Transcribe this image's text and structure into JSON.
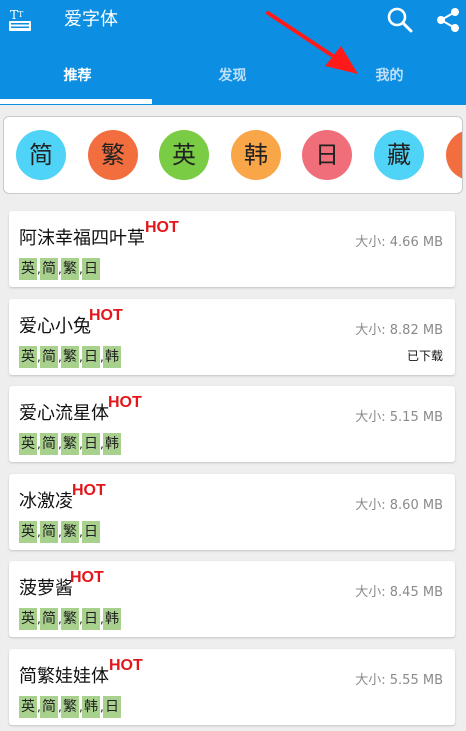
{
  "appbar": {
    "title": "爱字体",
    "tabs": [
      "推荐",
      "发现",
      "我的"
    ],
    "active_tab": 0,
    "color": "#0c8fe3"
  },
  "languages": [
    {
      "label": "简",
      "color": "#4fd3f7"
    },
    {
      "label": "繁",
      "color": "#f26e3f"
    },
    {
      "label": "英",
      "color": "#79cc43"
    },
    {
      "label": "韩",
      "color": "#f8a647"
    },
    {
      "label": "日",
      "color": "#f06e7a"
    },
    {
      "label": "藏",
      "color": "#4fd3f7"
    },
    {
      "label": "",
      "color": "#f26e3f"
    }
  ],
  "fonts": [
    {
      "name": "阿沫幸福四叶草",
      "hot": "HOT",
      "size": "大小: 4.66 MB",
      "tags": [
        "英",
        "简",
        "繁",
        "日"
      ],
      "status": ""
    },
    {
      "name": "爱心小兔",
      "hot": "HOT",
      "size": "大小: 8.82 MB",
      "tags": [
        "英",
        "简",
        "繁",
        "日",
        "韩"
      ],
      "status": "已下载"
    },
    {
      "name": "爱心流星体",
      "hot": "HOT",
      "size": "大小: 5.15 MB",
      "tags": [
        "英",
        "简",
        "繁",
        "日",
        "韩"
      ],
      "status": ""
    },
    {
      "name": "冰激凌",
      "hot": "HOT",
      "size": "大小: 8.60 MB",
      "tags": [
        "英",
        "简",
        "繁",
        "日"
      ],
      "status": ""
    },
    {
      "name": "菠萝酱",
      "hot": "HOT",
      "size": "大小: 8.45 MB",
      "tags": [
        "英",
        "简",
        "繁",
        "日",
        "韩"
      ],
      "status": ""
    },
    {
      "name": "简繁娃娃体",
      "hot": "HOT",
      "size": "大小: 5.55 MB",
      "tags": [
        "英",
        "简",
        "繁",
        "韩",
        "日"
      ],
      "status": ""
    }
  ]
}
